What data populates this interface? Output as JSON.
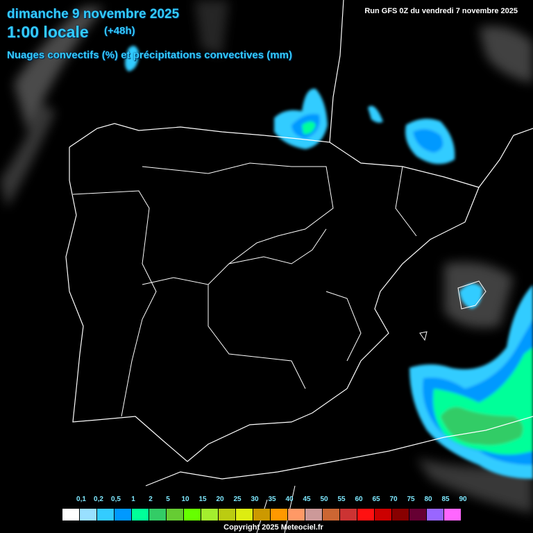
{
  "header": {
    "date": "dimanche 9 novembre 2025",
    "time": "1:00 locale",
    "lead": "(+48h)",
    "parameter": "Nuages convectifs (%) et précipitations convectives (mm)",
    "run": "Run GFS 0Z du vendredi 7 novembre 2025"
  },
  "legend": {
    "labels": [
      "0,1",
      "0,2",
      "0,5",
      "1",
      "2",
      "5",
      "10",
      "15",
      "20",
      "25",
      "30",
      "35",
      "40",
      "45",
      "50",
      "55",
      "60",
      "65",
      "70",
      "75",
      "80",
      "85",
      "90"
    ],
    "colors": [
      "#ffffff",
      "#99e0ff",
      "#33ccff",
      "#0099ff",
      "#00ff99",
      "#33cc66",
      "#66cc33",
      "#66ff00",
      "#a3ef2e",
      "#bbcc11",
      "#dded11",
      "#cc9900",
      "#ff9900",
      "#ff9966",
      "#cc9999",
      "#cc6633",
      "#cc3333",
      "#ff1111",
      "#cc0000",
      "#880000",
      "#660033",
      "#9966ff",
      "#ff66ff"
    ]
  },
  "footer": {
    "copyright": "Copyright 2025 Meteociel.fr"
  }
}
